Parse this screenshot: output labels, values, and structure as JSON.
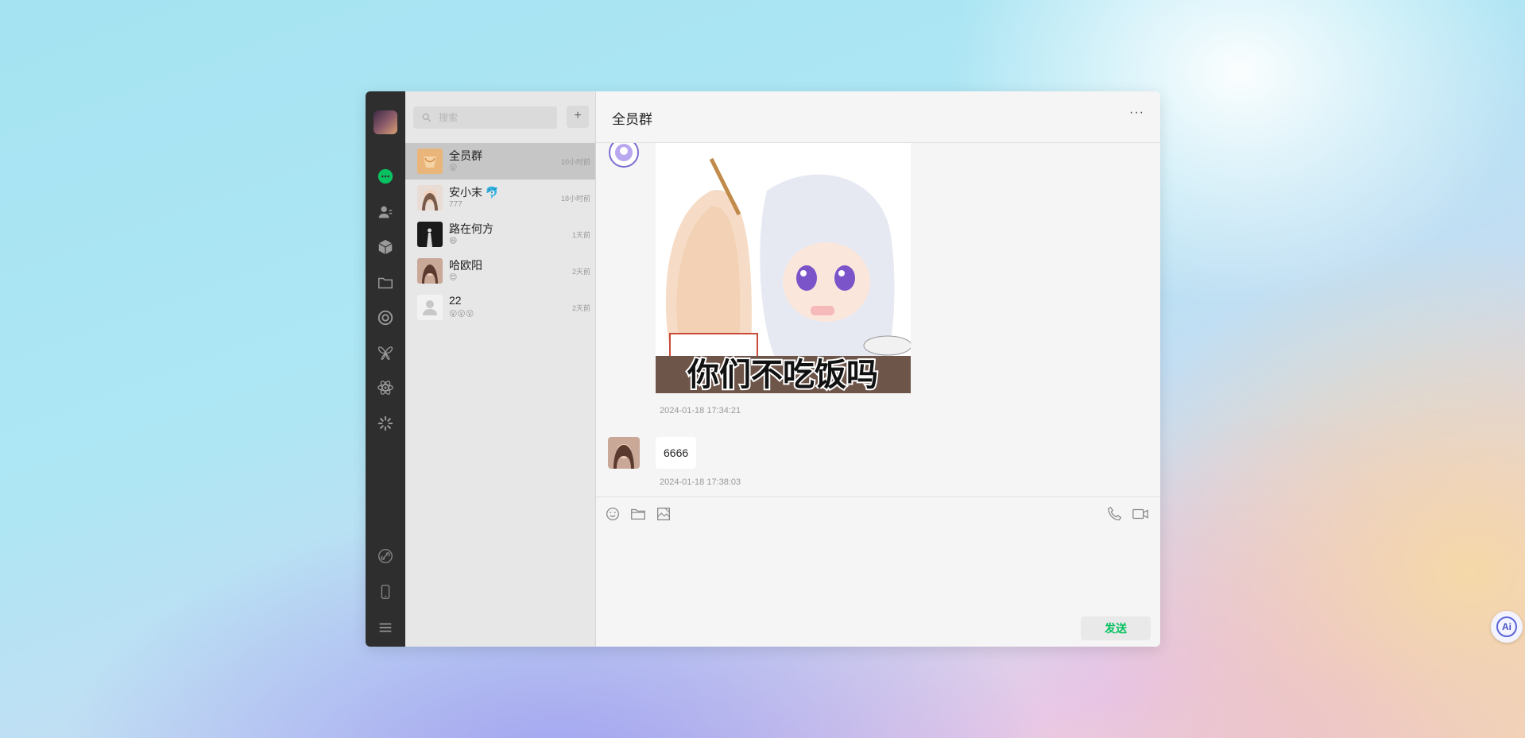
{
  "sidebar": {
    "icons": [
      "user-avatar",
      "chat-icon",
      "contacts-icon",
      "cube-icon",
      "folder-icon",
      "aperture-icon",
      "butterfly-icon",
      "atom-icon",
      "loading-icon",
      "link-icon",
      "phone-icon",
      "menu-icon"
    ]
  },
  "search": {
    "placeholder": "搜索"
  },
  "add_button": "+",
  "contacts": [
    {
      "name": "全员群",
      "preview": "😮",
      "time": "10小时前"
    },
    {
      "name": "安小末 🐬",
      "preview": "777",
      "time": "18小时前"
    },
    {
      "name": "路在何方",
      "preview": "😆",
      "time": "1天前"
    },
    {
      "name": "哈欧阳",
      "preview": "😍",
      "time": "2天前"
    },
    {
      "name": "22",
      "preview": "😮😮😮",
      "time": "2天前"
    }
  ],
  "chat": {
    "title": "全员群",
    "more_label": "···",
    "messages": [
      {
        "type": "sticker",
        "caption": "你们不吃饭吗",
        "timestamp": "2024-01-18 17:34:21"
      },
      {
        "type": "text",
        "text": "6666",
        "timestamp": "2024-01-18 17:38:03"
      }
    ],
    "toolbar": {
      "left": [
        "emoji-icon",
        "folder-icon",
        "screenshot-icon"
      ],
      "right": [
        "phone-call-icon",
        "video-call-icon"
      ]
    },
    "send_label": "发送"
  },
  "ai_button": "Ai",
  "colors": {
    "sidebar_bg": "#2e2e2e",
    "list_bg": "#e7e7e7",
    "active_item": "#c6c6c6",
    "chat_bg": "#f5f5f5",
    "accent_green": "#07c160"
  }
}
